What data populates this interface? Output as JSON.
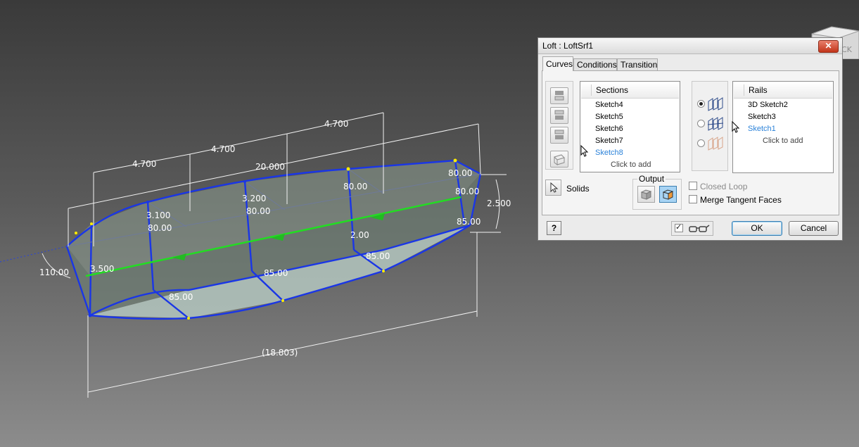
{
  "dialog": {
    "title": "Loft : LoftSrf1",
    "close_label": "✕",
    "tabs": [
      {
        "label": "Curves"
      },
      {
        "label": "Conditions"
      },
      {
        "label": "Transition"
      }
    ],
    "sections": {
      "header": "Sections",
      "items": [
        "Sketch4",
        "Sketch5",
        "Sketch6",
        "Sketch7",
        "Sketch8"
      ],
      "selected": "Sketch8",
      "add_prompt": "Click to add"
    },
    "rails": {
      "header": "Rails",
      "items": [
        "3D Sketch2",
        "Sketch3",
        "Sketch1"
      ],
      "selected": "Sketch1",
      "add_prompt": "Click to add"
    },
    "solids_label": "Solids",
    "output_label": "Output",
    "closed_loop_label": "Closed Loop",
    "merge_tangent_label": "Merge Tangent Faces",
    "help_label": "?",
    "ok_label": "OK",
    "cancel_label": "Cancel"
  },
  "viewcube": {
    "label": "CK"
  },
  "model_dimensions": {
    "top_4700_a": "4.700",
    "top_4700_b": "4.700",
    "top_4700_c": "4.700",
    "overall_20000": "20.000",
    "d_3100": "3.100",
    "d_3200": "3.200",
    "d_8000_a": "80.00",
    "d_8000_b": "80.00",
    "d_8000_c": "80.00",
    "d_8000_d": "80.00",
    "d_8000_e": "80.00",
    "d_2500": "2.500",
    "d_8500_a": "85.00",
    "d_8500_b": "85.00",
    "d_8500_c": "85.00",
    "d_8500_d": "85.00",
    "d_200": "2.00",
    "d_3500": "3.500",
    "d_110": "110.00",
    "bottom_18803": "(18.803)"
  }
}
